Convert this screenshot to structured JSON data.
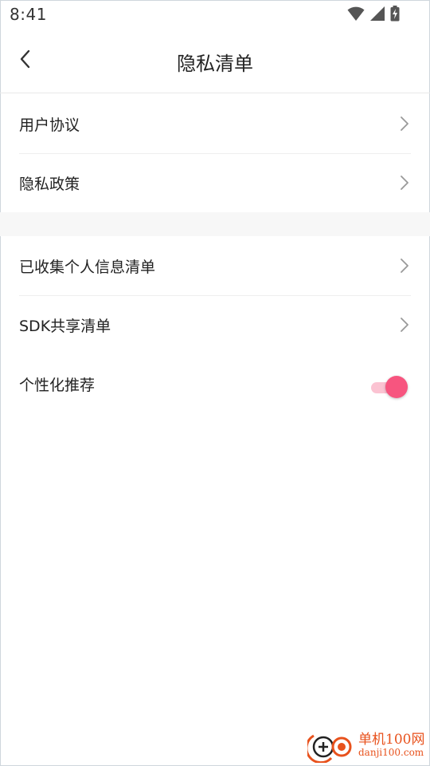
{
  "status_bar": {
    "time": "8:41",
    "icons": [
      "wifi-icon",
      "cell-signal-icon",
      "battery-charging-icon"
    ]
  },
  "header": {
    "back_icon": "chevron-left-icon",
    "title": "隐私清单"
  },
  "list": {
    "items": [
      {
        "label": "用户协议",
        "trailing": "chevron-right-icon"
      },
      {
        "label": "隐私政策",
        "trailing": "chevron-right-icon"
      },
      {
        "label": "已收集个人信息清单",
        "trailing": "chevron-right-icon"
      },
      {
        "label": "SDK共享清单",
        "trailing": "chevron-right-icon"
      },
      {
        "label": "个性化推荐",
        "trailing": "toggle",
        "enabled": true
      }
    ]
  },
  "watermark": {
    "name": "单机100网",
    "url": "danji100.com"
  },
  "colors": {
    "accent": "#f7557f",
    "accent_track": "#fbc3d2",
    "divider": "#eeeeee",
    "section_gap": "#f7f7f7",
    "watermark": "#e8521d"
  }
}
